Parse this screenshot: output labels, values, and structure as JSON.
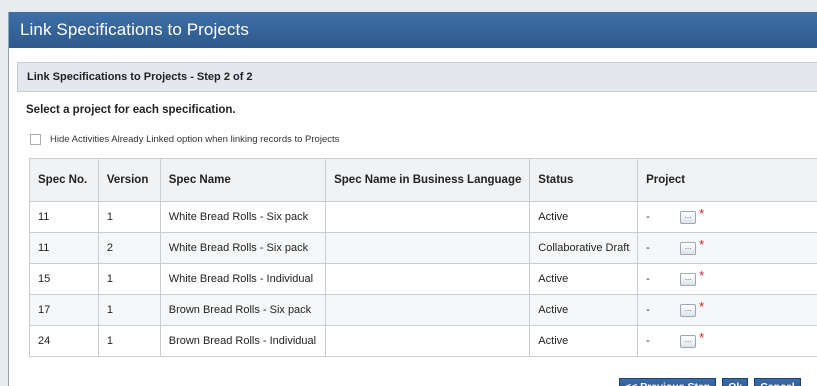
{
  "window": {
    "title": "Link Specifications to Projects"
  },
  "step": {
    "label": "Link Specifications to Projects - Step 2 of  2"
  },
  "instruction": "Select a project for each specification.",
  "option": {
    "label": "Hide Activities Already Linked option when linking records to Projects",
    "checked": false
  },
  "table": {
    "headers": [
      "Spec No.",
      "Version",
      "Spec Name",
      "Spec Name in Business Language",
      "Status",
      "Project"
    ],
    "rows": [
      {
        "spec_no": "11",
        "version": "1",
        "spec_name": "White Bread Rolls - Six pack",
        "business_name": "",
        "status": "Active",
        "project": "-"
      },
      {
        "spec_no": "11",
        "version": "2",
        "spec_name": "White Bread Rolls - Six pack",
        "business_name": "",
        "status": "Collaborative Draft",
        "project": "-"
      },
      {
        "spec_no": "15",
        "version": "1",
        "spec_name": "White Bread Rolls - Individual",
        "business_name": "",
        "status": "Active",
        "project": "-"
      },
      {
        "spec_no": "17",
        "version": "1",
        "spec_name": "Brown Bread Rolls - Six pack",
        "business_name": "",
        "status": "Active",
        "project": "-"
      },
      {
        "spec_no": "24",
        "version": "1",
        "spec_name": "Brown Bread Rolls - Individual",
        "business_name": "",
        "status": "Active",
        "project": "-"
      }
    ],
    "picker_label": "...",
    "required_mark": "*"
  },
  "buttons": {
    "previous": "<< Previous Step",
    "ok": "Ok",
    "cancel": "Cancel"
  },
  "colors": {
    "titlebar": "#2d5a8e",
    "button": "#24508a",
    "required": "#dd2222"
  }
}
